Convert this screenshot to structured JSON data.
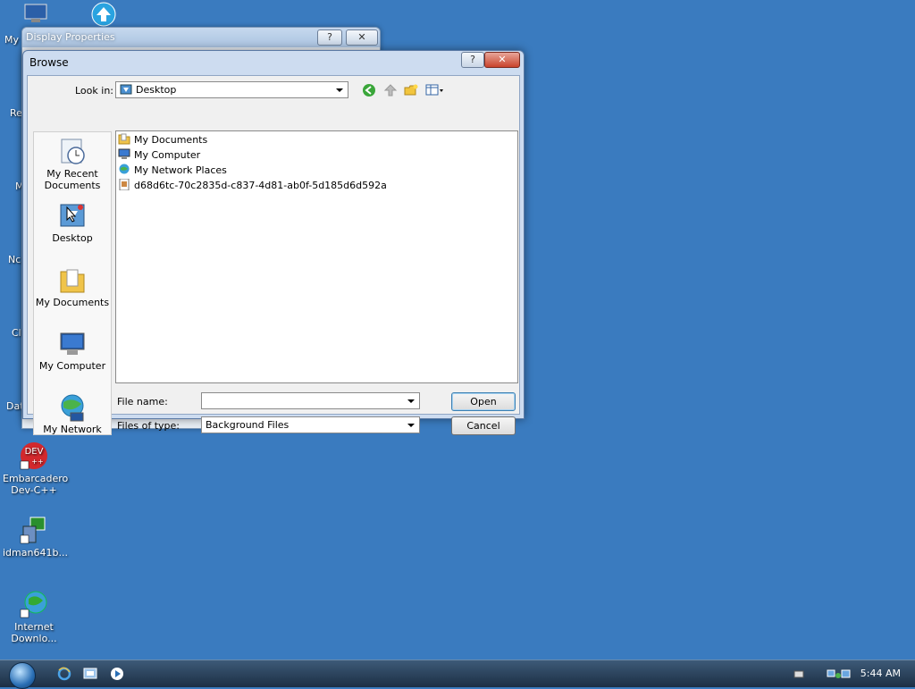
{
  "desktop": {
    "partial_labels": [
      "My",
      "Re",
      "M",
      "Nc",
      "Cl",
      "Dat"
    ],
    "icons": [
      {
        "label": "Embarcadero Dev-C++",
        "badge": "DEV"
      },
      {
        "label": "idman641b..."
      },
      {
        "label": "Internet Downlo..."
      }
    ]
  },
  "background_window": {
    "title": "Display Properties",
    "help_label": "?",
    "close_label": "✕"
  },
  "dialog": {
    "title": "Browse",
    "help_label": "?",
    "close_label": "✕",
    "look_in_label": "Look in:",
    "look_in_value": "Desktop",
    "places": [
      {
        "label": "My Recent Documents",
        "icon": "recent-documents-icon"
      },
      {
        "label": "Desktop",
        "icon": "desktop-icon"
      },
      {
        "label": "My Documents",
        "icon": "folder-icon"
      },
      {
        "label": "My Computer",
        "icon": "computer-icon"
      },
      {
        "label": "My Network",
        "icon": "network-icon"
      }
    ],
    "files": [
      {
        "name": "My Documents",
        "icon": "folder-icon"
      },
      {
        "name": "My Computer",
        "icon": "computer-icon"
      },
      {
        "name": "My Network Places",
        "icon": "network-icon"
      },
      {
        "name": "d68d6tc-70c2835d-c837-4d81-ab0f-5d185d6d592a",
        "icon": "image-file-icon"
      }
    ],
    "file_name_label": "File name:",
    "file_name_value": "",
    "files_of_type_label": "Files of type:",
    "files_of_type_value": "Background Files",
    "open_label": "Open",
    "cancel_label": "Cancel"
  },
  "taskbar": {
    "clock": "5:44 AM"
  },
  "colors": {
    "desktop_bg": "#3a7bbf",
    "dialog_frame": "#cddcf0",
    "close_red": "#c9432c"
  }
}
